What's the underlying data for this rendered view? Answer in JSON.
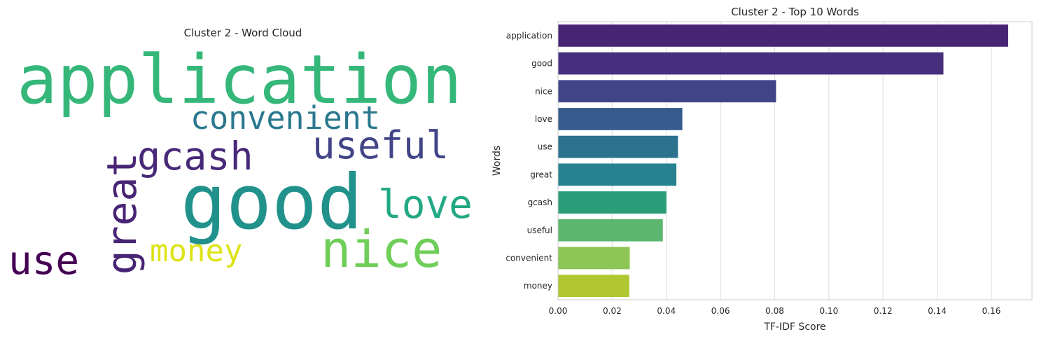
{
  "wordcloud": {
    "title": "Cluster 2 - Word Cloud",
    "words": [
      {
        "text": "application",
        "color": "#35b779"
      },
      {
        "text": "convenient",
        "color": "#2a788e"
      },
      {
        "text": "useful",
        "color": "#414487"
      },
      {
        "text": "gcash",
        "color": "#482878"
      },
      {
        "text": "great",
        "color": "#482475"
      },
      {
        "text": "good",
        "color": "#21918c"
      },
      {
        "text": "love",
        "color": "#22a884"
      },
      {
        "text": "use",
        "color": "#440154"
      },
      {
        "text": "money",
        "color": "#dde318"
      },
      {
        "text": "nice",
        "color": "#6ece58"
      }
    ]
  },
  "chart_data": {
    "type": "bar",
    "orientation": "horizontal",
    "title": "Cluster 2 - Top 10 Words",
    "xlabel": "TF-IDF Score",
    "ylabel": "Words",
    "categories": [
      "application",
      "good",
      "nice",
      "love",
      "use",
      "great",
      "gcash",
      "useful",
      "convenient",
      "money"
    ],
    "values": [
      0.1662,
      0.1423,
      0.0805,
      0.0459,
      0.0443,
      0.0437,
      0.04,
      0.0387,
      0.0265,
      0.0263
    ],
    "colors": [
      "#482475",
      "#472f7d",
      "#414487",
      "#365c8d",
      "#2c728e",
      "#26828e",
      "#2a9d78",
      "#5cb870",
      "#8dc656",
      "#b0c732"
    ],
    "xlim": [
      0,
      0.175
    ],
    "xticks": [
      "0.00",
      "0.02",
      "0.04",
      "0.06",
      "0.08",
      "0.10",
      "0.12",
      "0.14",
      "0.16"
    ],
    "grid": "vertical"
  }
}
